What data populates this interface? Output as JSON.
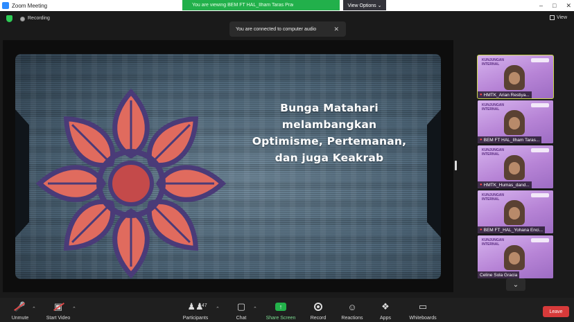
{
  "window": {
    "title": "Zoom Meeting",
    "share_banner_text": "You are viewing BEM FT HAL_Ilham Taras Pradana...'s screen",
    "view_options_label": "View Options ⌄"
  },
  "topbar": {
    "recording_label": "Recording",
    "view_label": "View"
  },
  "toast": {
    "message": "You are connected to computer audio",
    "close": "✕"
  },
  "slide": {
    "lines": [
      "Bunga Matahari",
      "melambangkan",
      "Optimisme, Pertemanan,",
      "dan juga Keakrab"
    ]
  },
  "participants": [
    {
      "name": "HMTK_Arian Restiya...",
      "muted": true
    },
    {
      "name": "BEM FT HAL_Ilham Taras...",
      "muted": false
    },
    {
      "name": "HMTK_Humas_dand...",
      "muted": false
    },
    {
      "name": "BEM FT_HAL_Yohana Enci...",
      "muted": false
    },
    {
      "name": "Celine Sola Gracia",
      "muted": false
    }
  ],
  "thumb_brand": "KUNJUNGAN\nINTERNAL",
  "toolbar": {
    "unmute": "Unmute",
    "start_video": "Start Video",
    "participants": "Participants",
    "participants_count": "147",
    "chat": "Chat",
    "share_screen": "Share Screen",
    "record": "Record",
    "reactions": "Reactions",
    "apps": "Apps",
    "whiteboards": "Whiteboards",
    "leave": "Leave"
  },
  "colors": {
    "share_green": "#22b04b",
    "leave_red": "#d73a3a",
    "active_speaker": "#c9d84a",
    "thumb_purple": "#b784d6",
    "petal_red": "#e06b5e",
    "petal_outline": "#4a3b78"
  },
  "icons": [
    "zoom-logo-icon",
    "shield-icon",
    "record-icon",
    "grid-view-icon",
    "close-icon",
    "mic-muted-icon",
    "video-off-icon",
    "participants-icon",
    "chat-icon",
    "share-screen-icon",
    "reactions-icon",
    "apps-icon",
    "whiteboard-icon",
    "chevron-down-icon"
  ]
}
